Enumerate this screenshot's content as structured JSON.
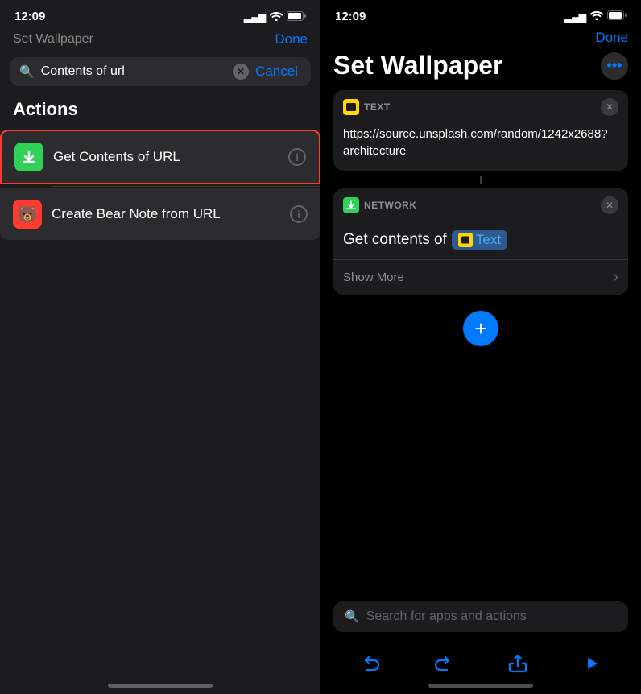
{
  "left": {
    "status_time": "12:09",
    "peek_title": "Set Wallpaper",
    "done_peek": "Done",
    "search_value": "Contents of url",
    "cancel_label": "Cancel",
    "section_title": "Actions",
    "actions": [
      {
        "id": "get-contents-url",
        "label": "Get Contents of URL",
        "icon_type": "green",
        "selected": true
      },
      {
        "id": "create-bear-note",
        "label": "Create Bear Note from URL",
        "icon_type": "red",
        "selected": false
      }
    ]
  },
  "right": {
    "status_time": "12:09",
    "done_label": "Done",
    "title": "Set Wallpaper",
    "text_card": {
      "type_label": "TEXT",
      "url": "https://source.unsplash.com/random/1242x2688?architecture"
    },
    "network_card": {
      "type_label": "NETWORK",
      "action_text": "Get contents of",
      "token_label": "Text",
      "show_more": "Show More"
    },
    "search_placeholder": "Search for apps and actions",
    "add_btn_label": "+"
  },
  "icons": {
    "search": "🔍",
    "clear": "✕",
    "info": "i",
    "close": "✕",
    "chevron_right": "›",
    "undo": "↩",
    "redo": "↪",
    "share": "↑",
    "play": "▶",
    "more": "···",
    "signal_bars": "▂▄▆",
    "wifi": "wifi",
    "battery": "battery",
    "download_arrow": "↓",
    "bear": "🐻"
  }
}
